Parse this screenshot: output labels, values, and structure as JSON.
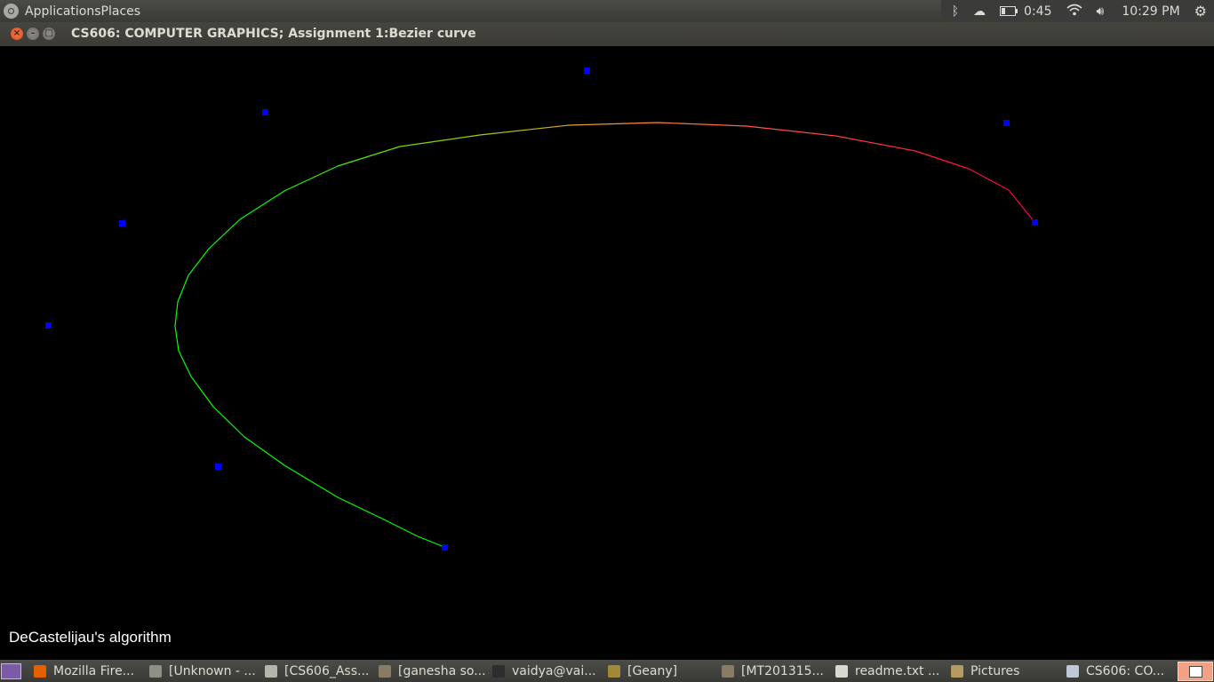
{
  "top_panel": {
    "applications": "Applications",
    "places": "Places",
    "battery": "0:45",
    "clock": "10:29 PM",
    "icons": [
      "bluetooth-icon",
      "cloud-icon",
      "battery-icon",
      "wifi-icon",
      "volume-icon",
      "gear-icon"
    ]
  },
  "window": {
    "title": "CS606: COMPUTER GRAPHICS; Assignment 1:Bezier curve",
    "close_glyph": "×",
    "min_glyph": "–",
    "max_glyph": "□"
  },
  "canvas": {
    "label": "DeCastelijau's algorithm",
    "background": "#000000",
    "control_point_color": "#0000ff",
    "curve_start_color": "#00ff00",
    "curve_end_color": "#ff0033"
  },
  "taskbar": {
    "items": [
      {
        "label": "Mozilla Fire...",
        "icon": "firefox-icon",
        "color": "#e66000"
      },
      {
        "label": "[Unknown - ...",
        "icon": "document-viewer-icon",
        "color": "#8f8f85"
      },
      {
        "label": "[CS606_Ass...",
        "icon": "document-icon",
        "color": "#b5b5ad"
      },
      {
        "label": "[ganesha so...",
        "icon": "file-manager-icon",
        "color": "#8a7b65"
      },
      {
        "label": "vaidya@vai...",
        "icon": "terminal-icon",
        "color": "#2d2d2d"
      },
      {
        "label": "[Geany]",
        "icon": "geany-icon",
        "color": "#a08a3a"
      },
      {
        "label": "[MT201315...",
        "icon": "file-manager-icon",
        "color": "#8a7b65"
      },
      {
        "label": "readme.txt ...",
        "icon": "text-editor-icon",
        "color": "#d8d8d0"
      },
      {
        "label": "Pictures",
        "icon": "folder-icon",
        "color": "#b59a62"
      },
      {
        "label": "CS606: CO...",
        "icon": "window-icon",
        "color": "#c0c8d8"
      }
    ]
  }
}
